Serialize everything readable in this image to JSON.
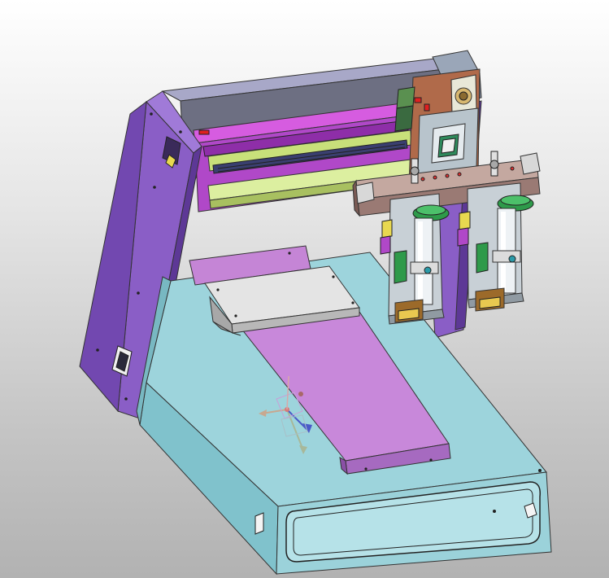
{
  "viewport": {
    "background_top": "#ffffff",
    "background_bottom": "#b2b2b2"
  },
  "model": {
    "parts": [
      {
        "name": "base-housing",
        "color": "#8fd0d8"
      },
      {
        "name": "gantry-side-frame",
        "color": "#8a5ec6"
      },
      {
        "name": "x-axis-beam",
        "color": "#b048c8"
      },
      {
        "name": "linear-guide-rail",
        "color": "#c8e07a"
      },
      {
        "name": "work-table",
        "color": "#c585d6"
      },
      {
        "name": "fixture-plate",
        "color": "#d8d8d8"
      },
      {
        "name": "carriage-plate",
        "color": "#a0624a"
      },
      {
        "name": "z-axis-cylinder",
        "color": "#e8eef2"
      },
      {
        "name": "green-knob",
        "color": "#2e9a4a"
      },
      {
        "name": "nozzle-base",
        "color": "#9c6a2a"
      }
    ],
    "triad_axes": [
      "x-axis",
      "y-axis",
      "z-axis"
    ]
  }
}
